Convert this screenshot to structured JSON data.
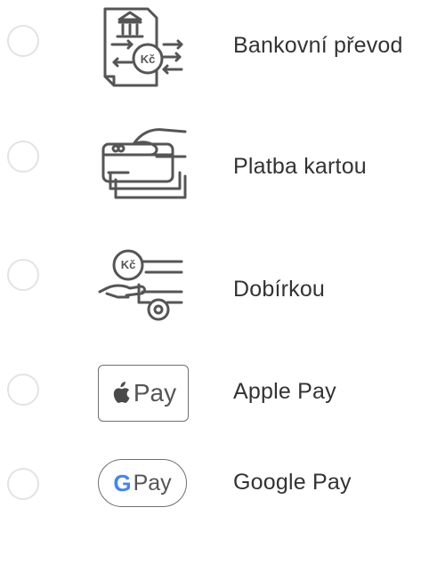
{
  "payment_methods": [
    {
      "label": "Bankovní převod",
      "icon": "bank-transfer-icon",
      "currency_badge": "Kč",
      "selected": false
    },
    {
      "label": "Platba kartou",
      "icon": "card-payment-icon",
      "selected": false
    },
    {
      "label": "Dobírkou",
      "icon": "cash-on-delivery-icon",
      "currency_badge": "Kč",
      "selected": false
    },
    {
      "label": "Apple Pay",
      "icon": "apple-pay-icon",
      "badge_text": "Pay",
      "selected": false
    },
    {
      "label": "Google Pay",
      "icon": "google-pay-icon",
      "badge_letter": "G",
      "badge_text": "Pay",
      "selected": false
    }
  ],
  "colors": {
    "icon_stroke": "#555555",
    "radio_border": "#e3e3e3",
    "label_text": "#333333",
    "google_blue": "#4285F4"
  }
}
